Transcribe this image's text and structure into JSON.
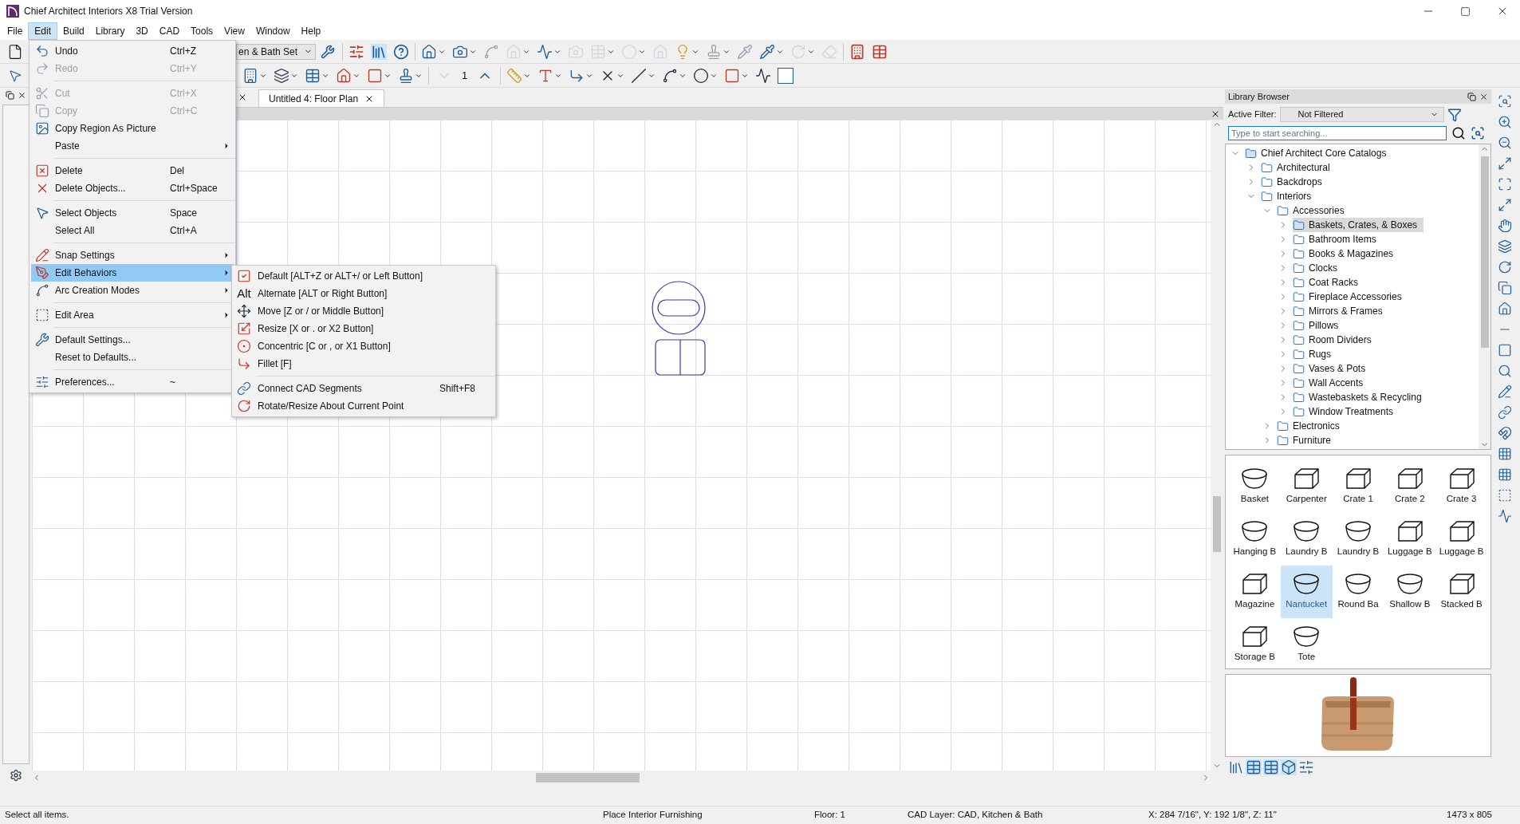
{
  "window": {
    "title": "Chief Architect Interiors X8 Trial Version"
  },
  "menu_bar": [
    {
      "label": "File",
      "selected": false
    },
    {
      "label": "Edit",
      "selected": true
    },
    {
      "label": "Build",
      "selected": false
    },
    {
      "label": "Library",
      "selected": false
    },
    {
      "label": "3D",
      "selected": false
    },
    {
      "label": "CAD",
      "selected": false
    },
    {
      "label": "Tools",
      "selected": false
    },
    {
      "label": "View",
      "selected": false
    },
    {
      "label": "Window",
      "selected": false
    },
    {
      "label": "Help",
      "selected": false
    }
  ],
  "toolbar": {
    "set_dropdown": "en & Bath Set",
    "floor_number": "1"
  },
  "tabs": [
    {
      "label": "Untitled 4: Floor Plan",
      "selected": true
    }
  ],
  "edit_menu": [
    {
      "kind": "command",
      "label": "Undo",
      "shortcut": "Ctrl+Z",
      "disabled": false,
      "selected": false
    },
    {
      "kind": "command",
      "label": "Redo",
      "shortcut": "Ctrl+Y",
      "disabled": true,
      "selected": false
    },
    {
      "kind": "separator"
    },
    {
      "kind": "command",
      "label": "Cut",
      "shortcut": "Ctrl+X",
      "disabled": true,
      "selected": false
    },
    {
      "kind": "command",
      "label": "Copy",
      "shortcut": "Ctrl+C",
      "disabled": true,
      "selected": false
    },
    {
      "kind": "command",
      "label": "Copy Region As Picture",
      "disabled": false,
      "selected": false
    },
    {
      "kind": "submenu",
      "label": "Paste",
      "disabled": false,
      "selected": false
    },
    {
      "kind": "separator"
    },
    {
      "kind": "command",
      "label": "Delete",
      "shortcut": "Del",
      "disabled": false,
      "selected": false
    },
    {
      "kind": "command",
      "label": "Delete Objects...",
      "shortcut": "Ctrl+Space",
      "disabled": false,
      "selected": false
    },
    {
      "kind": "separator"
    },
    {
      "kind": "command",
      "label": "Select Objects",
      "shortcut": "Space",
      "disabled": false,
      "selected": false
    },
    {
      "kind": "command",
      "label": "Select All",
      "shortcut": "Ctrl+A",
      "disabled": false,
      "selected": false
    },
    {
      "kind": "separator"
    },
    {
      "kind": "submenu",
      "label": "Snap Settings",
      "disabled": false,
      "selected": false
    },
    {
      "kind": "submenu",
      "label": "Edit Behaviors",
      "disabled": false,
      "selected": true
    },
    {
      "kind": "submenu",
      "label": "Arc Creation Modes",
      "disabled": false,
      "selected": false
    },
    {
      "kind": "separator"
    },
    {
      "kind": "submenu",
      "label": "Edit Area",
      "disabled": false,
      "selected": false
    },
    {
      "kind": "separator"
    },
    {
      "kind": "command",
      "label": "Default Settings...",
      "disabled": false,
      "selected": false
    },
    {
      "kind": "command",
      "label": "Reset to Defaults...",
      "disabled": false,
      "selected": false
    },
    {
      "kind": "separator"
    },
    {
      "kind": "command",
      "label": "Preferences...",
      "shortcut": "~",
      "disabled": false,
      "selected": false
    }
  ],
  "edit_behaviors_submenu": [
    {
      "kind": "command",
      "label": "Default [ALT+Z or ALT+/ or Left Button]"
    },
    {
      "kind": "command",
      "label": "Alternate [ALT or Right Button]",
      "icon_text": "Alt"
    },
    {
      "kind": "command",
      "label": "Move [Z or / or Middle Button]"
    },
    {
      "kind": "command",
      "label": "Resize [X or . or X2 Button]"
    },
    {
      "kind": "command",
      "label": "Concentric [C or , or X1 Button]"
    },
    {
      "kind": "command",
      "label": "Fillet [F]"
    },
    {
      "kind": "separator"
    },
    {
      "kind": "command",
      "label": "Connect CAD Segments",
      "shortcut": "Shift+F8"
    },
    {
      "kind": "command",
      "label": "Rotate/Resize About Current Point"
    }
  ],
  "library_browser": {
    "title": "Library Browser",
    "filter_label": "Active Filter:",
    "filter_value": "Not Filtered",
    "search": {
      "placeholder": "Type to start searching..."
    },
    "tree": [
      {
        "label": "Chief Architect Core Catalogs",
        "expanded": true,
        "selected": false,
        "children": [
          {
            "label": "Architectural",
            "expanded": false,
            "selected": false
          },
          {
            "label": "Backdrops",
            "expanded": false,
            "selected": false
          },
          {
            "label": "Interiors",
            "expanded": true,
            "selected": false,
            "children": [
              {
                "label": "Accessories",
                "expanded": true,
                "selected": false,
                "children": [
                  {
                    "label": "Baskets, Crates, & Boxes",
                    "expanded": false,
                    "selected": true
                  },
                  {
                    "label": "Bathroom Items",
                    "expanded": false,
                    "selected": false
                  },
                  {
                    "label": "Books & Magazines",
                    "expanded": false,
                    "selected": false
                  },
                  {
                    "label": "Clocks",
                    "expanded": false,
                    "selected": false
                  },
                  {
                    "label": "Coat Racks",
                    "expanded": false,
                    "selected": false
                  },
                  {
                    "label": "Fireplace Accessories",
                    "expanded": false,
                    "selected": false
                  },
                  {
                    "label": "Mirrors & Frames",
                    "expanded": false,
                    "selected": false
                  },
                  {
                    "label": "Pillows",
                    "expanded": false,
                    "selected": false
                  },
                  {
                    "label": "Room Dividers",
                    "expanded": false,
                    "selected": false
                  },
                  {
                    "label": "Rugs",
                    "expanded": false,
                    "selected": false
                  },
                  {
                    "label": "Vases & Pots",
                    "expanded": false,
                    "selected": false
                  },
                  {
                    "label": "Wall Accents",
                    "expanded": false,
                    "selected": false
                  },
                  {
                    "label": "Wastebaskets & Recycling",
                    "expanded": false,
                    "selected": false
                  },
                  {
                    "label": "Window Treatments",
                    "expanded": false,
                    "selected": false
                  }
                ]
              },
              {
                "label": "Electronics",
                "expanded": false,
                "selected": false
              },
              {
                "label": "Furniture",
                "expanded": false,
                "selected": false
              }
            ]
          }
        ]
      }
    ],
    "items": [
      {
        "label": "Basket",
        "kind": "basket",
        "selected": false
      },
      {
        "label": "Carpenter",
        "kind": "box",
        "selected": false
      },
      {
        "label": "Crate 1",
        "kind": "box",
        "selected": false
      },
      {
        "label": "Crate 2",
        "kind": "box",
        "selected": false
      },
      {
        "label": "Crate 3",
        "kind": "box",
        "selected": false
      },
      {
        "label": "Hanging B",
        "kind": "basket",
        "selected": false
      },
      {
        "label": "Laundry B",
        "kind": "basket",
        "selected": false
      },
      {
        "label": "Laundry B",
        "kind": "basket",
        "selected": false
      },
      {
        "label": "Luggage B",
        "kind": "box",
        "selected": false
      },
      {
        "label": "Luggage B",
        "kind": "box",
        "selected": false
      },
      {
        "label": "Magazine",
        "kind": "box",
        "selected": false
      },
      {
        "label": "Nantucket",
        "kind": "basket",
        "selected": true
      },
      {
        "label": "Round Ba",
        "kind": "basket",
        "selected": false
      },
      {
        "label": "Shallow B",
        "kind": "basket",
        "selected": false
      },
      {
        "label": "Stacked B",
        "kind": "box",
        "selected": false
      },
      {
        "label": "Storage B",
        "kind": "box",
        "selected": false
      },
      {
        "label": "Tote",
        "kind": "basket",
        "selected": false
      }
    ]
  },
  "status_bar": [
    "Select all items.",
    "Place Interior Furnishing",
    "Floor: 1",
    "CAD Layer: CAD, Kitchen & Bath",
    "X: 284 7/16\", Y: 192 1/8\", Z: 11\"",
    "1473 x 805"
  ]
}
